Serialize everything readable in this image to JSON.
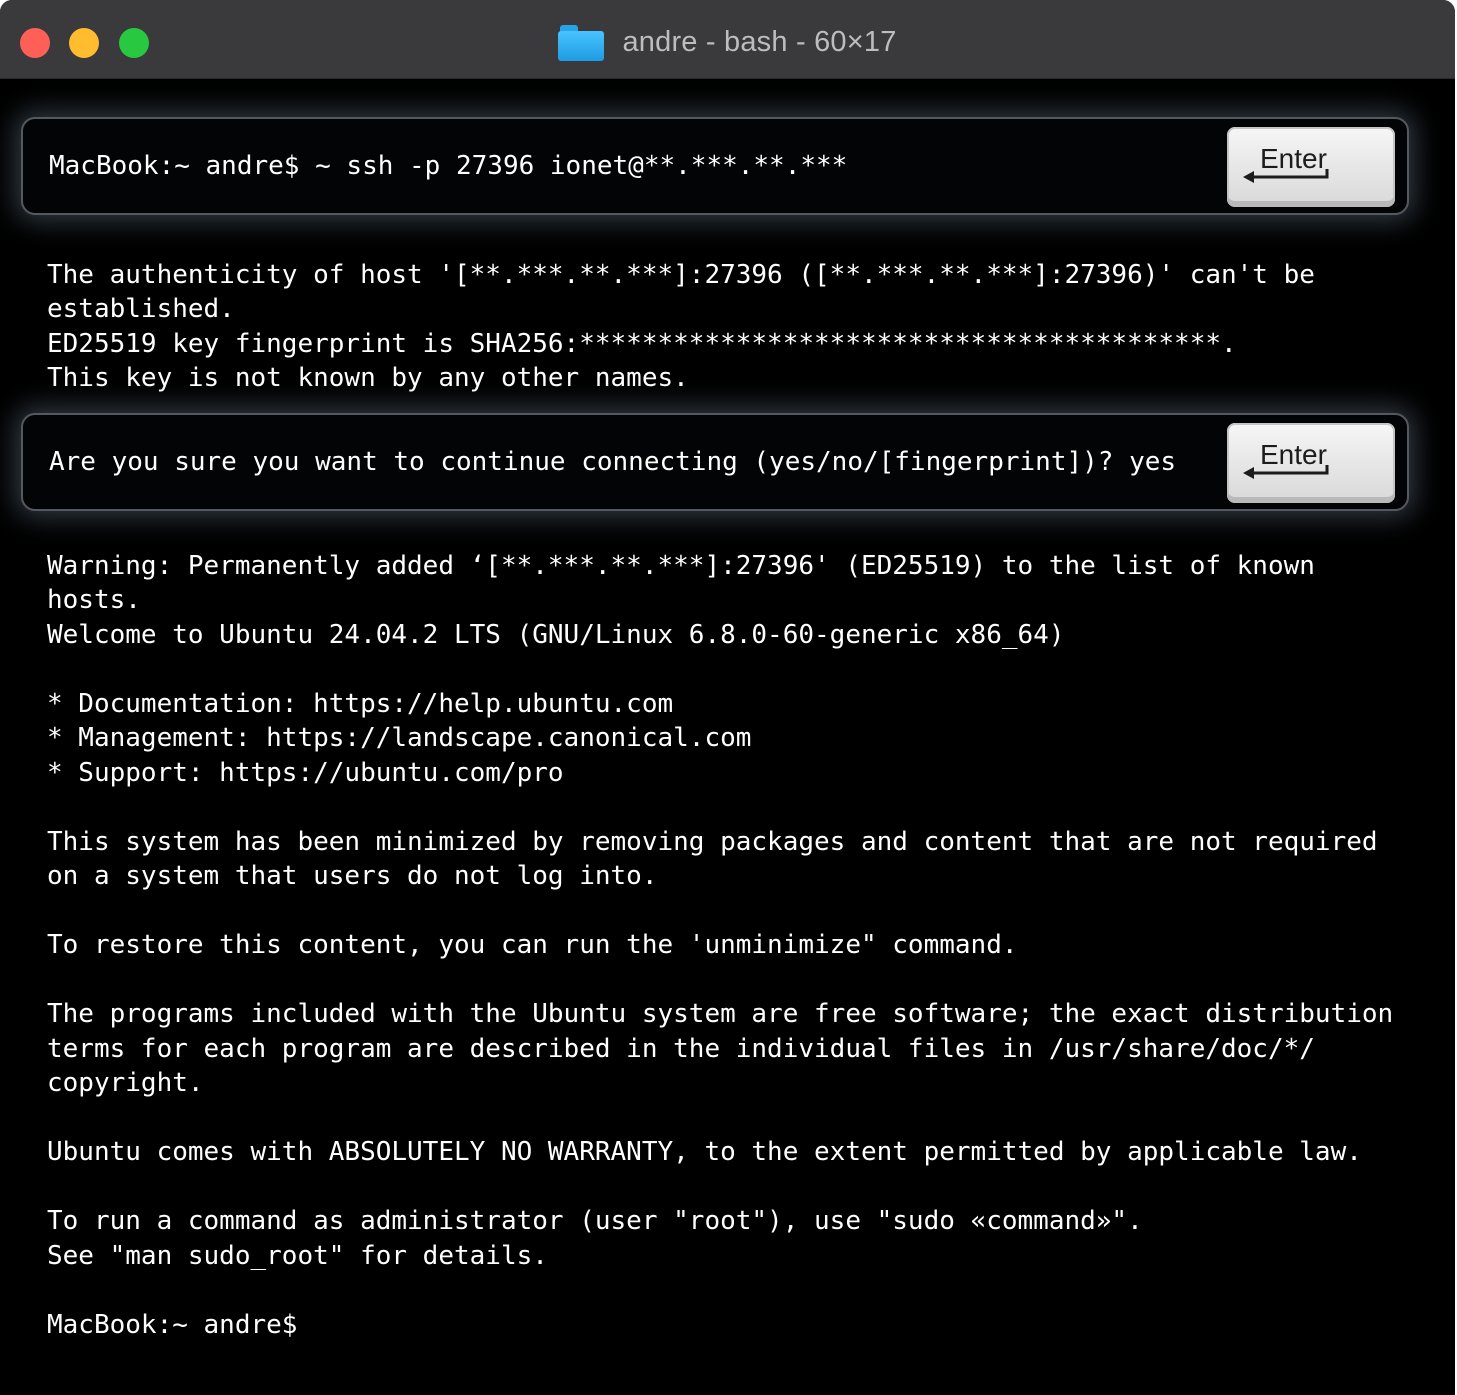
{
  "window": {
    "title": "andre - bash - 60×17",
    "folder_icon": "folder-icon",
    "colors": {
      "close": "#fe5f57",
      "minimize": "#febc2e",
      "zoom": "#28c840",
      "background": "#000000"
    }
  },
  "callouts": {
    "command": "MacBook:~ andre$ ~ ssh -p 27396 ionet@**.***.**.***",
    "confirm": "Are you sure you want to continue connecting (yes/no/[fingerprint])? yes",
    "key_label": "Enter",
    "key_icon": "return-arrow-icon"
  },
  "output": {
    "auth_1": "The authenticity of host '[**.***.**.***]:27396 ([**.***.**.***]:27396)' can't be",
    "auth_2": "established.",
    "fingerprint": "ED25519 key fingerprint is SHA256:*****************************************.",
    "not_known": "This key is not known by any other names.",
    "warning_1": "Warning: Permanently added ‘[**.***.**.***]:27396' (ED25519) to the list of known",
    "warning_2": "hosts.",
    "welcome": "Welcome to Ubuntu 24.04.2 LTS (GNU/Linux 6.8.0-60-generic x86_64)",
    "doc": "* Documentation: https://help.ubuntu.com",
    "mgmt": "* Management: https://landscape.canonical.com",
    "support": "* Support: https://ubuntu.com/pro",
    "minimized_1": "This system has been minimized by removing packages and content that are not required",
    "minimized_2": "on a system that users do not log into.",
    "restore": "To restore this content, you can run the 'unminimize\" command.",
    "programs_1": "The programs included with the Ubuntu system are free software; the exact distribution",
    "programs_2": "terms for each program are described in the individual files in /usr/share/doc/*/",
    "programs_3": "copyright.",
    "warranty": "Ubuntu comes with ABSOLUTELY NO WARRANTY, to the extent permitted by applicable law.",
    "sudo_1": "To run a command as administrator (user \"root\"), use \"sudo «command»\".",
    "sudo_2": "See \"man sudo_root\" for details.",
    "prompt": "MacBook:~ andre$"
  }
}
